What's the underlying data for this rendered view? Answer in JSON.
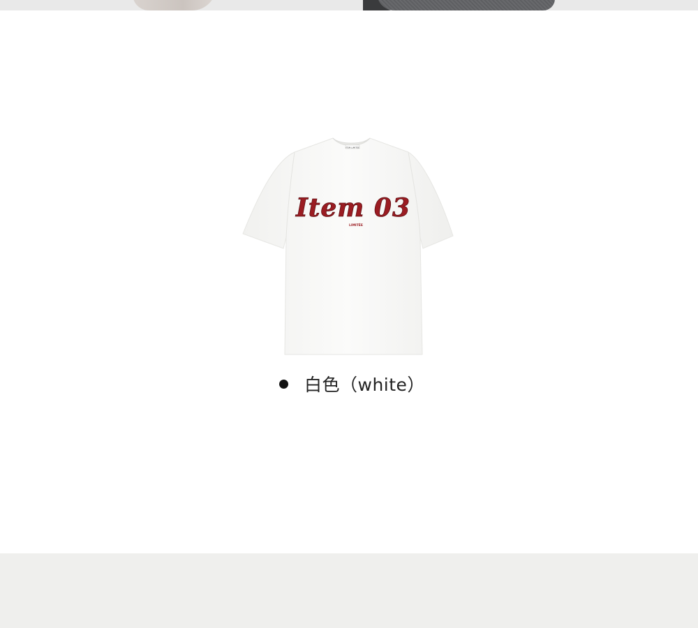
{
  "product": {
    "print_text": "Item 03",
    "print_subtext": "LIMITÉE",
    "collar_tag": "ITEM LIMITÉE",
    "color_option_label": "白色（white）",
    "garment_color": "#f8f8f6",
    "print_color": "#9b1c22"
  },
  "page": {
    "background": "#ffffff",
    "bottom_band_color": "#efefed"
  }
}
